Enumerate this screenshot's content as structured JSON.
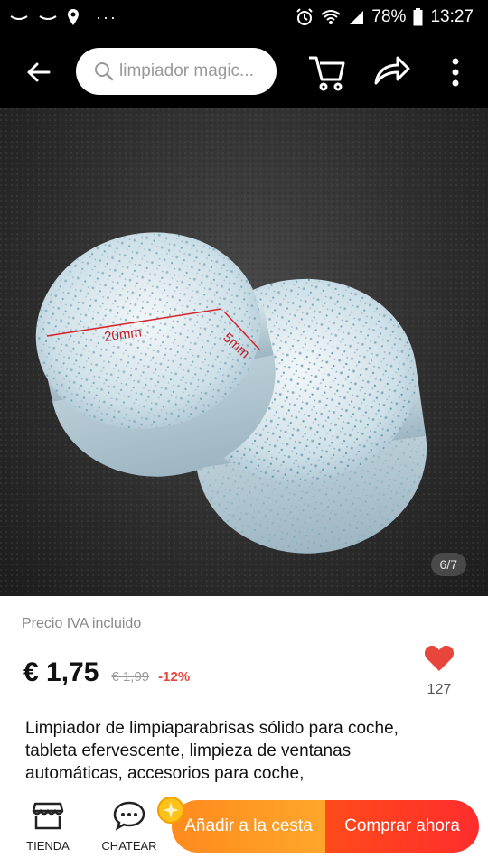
{
  "status_bar": {
    "battery": "78%",
    "time": "13:27",
    "dots": "···"
  },
  "search": {
    "query": "limpiador magic..."
  },
  "gallery": {
    "image_label_diameter": "20mm",
    "image_label_thickness": "5mm",
    "counter": "6/7"
  },
  "product": {
    "tax_note": "Precio IVA incluido",
    "price": "€ 1,75",
    "old_price": "€ 1,99",
    "discount": "-12%",
    "favorites": "127",
    "title": "Limpiador de limpiaparabrisas sólido para coche, tableta efervescente, limpieza de ventanas automáticas, accesorios para coche,"
  },
  "bottom_bar": {
    "store_label": "TIENDA",
    "chat_label": "CHATEAR",
    "add_to_cart": "Añadir a la cesta",
    "buy_now": "Comprar ahora"
  },
  "colors": {
    "accent": "#ff4a1a",
    "orange": "#ff8a1e",
    "heart": "#e8453c",
    "discount": "#e8453c"
  }
}
